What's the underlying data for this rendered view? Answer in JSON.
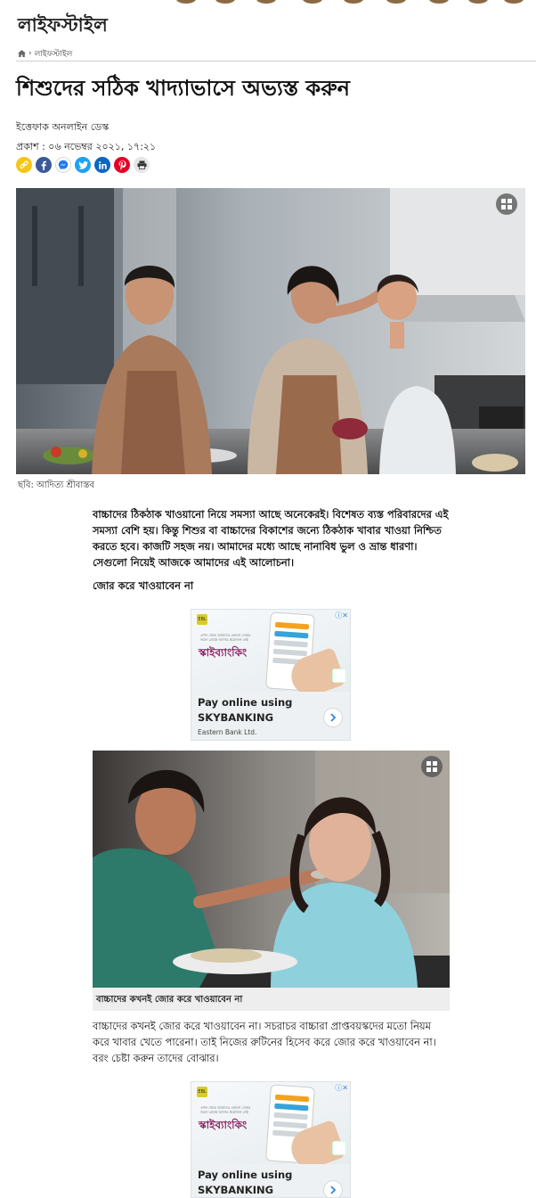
{
  "section": {
    "title": "লাইফস্টাইল"
  },
  "breadcrumb": {
    "home_icon": "home-icon",
    "separator": "›",
    "current": "লাইফস্টাইল"
  },
  "article": {
    "headline": "শিশুদের সঠিক খাদ্যাভাসে অভ্যস্ত করুন",
    "byline": "ইত্তেফাক অনলাইন ডেস্ক",
    "published": "প্রকাশ : ০৬ নভেম্বর ২০২১, ১৭:২১",
    "share_icons": [
      "link-icon",
      "facebook-icon",
      "messenger-icon",
      "twitter-icon",
      "linkedin-icon",
      "pinterest-icon",
      "print-icon"
    ],
    "main_image_caption": "ছবি: আদিত্য শ্রীবাস্তব",
    "intro": "বাচ্চাদের ঠিকঠাক খাওয়ানো নিয়ে সমস্যা আছে অনেকেরই। বিশেষত ব্যস্ত পরিবারদের এই সমস্যা বেশি হয়। কিন্তু শিশুর বা বাচ্চাদের বিকাশের জন্যে ঠিকঠাক খাবার খাওয়া নিশ্চিত করতে হবে। কাজটি সহজ নয়। আমাদের মধ্যে আছে নানাবিধ ভুল ও ভ্রান্ত ধারণা। সেগুলো নিয়েই আজকে আমাদের এই আলোচনা।",
    "subheading": "জোর করে খাওয়াবেন না",
    "second_image_caption": "বাচ্চাদের কখনই জোর করে খাওয়াবেন না",
    "paragraph2": "বাচ্চাদের কখনই জোর করে খাওয়াবেন না। সচরাচর বাচ্চারা প্রাপ্তবয়স্কদের মতো নিয়ম করে খাবার খেতে পারেনা। তাই নিজের রুটিনের হিসেব করে জোর করে খাওয়াবেন না। বরং চেষ্টা করুন তাদের বোঝার।"
  },
  "ads": [
    {
      "small_text": "এখন থেকে আমাদের কোনো সেবার জন্যে ব্রাঞ্চে আসার প্রয়োজন নেই",
      "brand": "স্কাইব্যাংকিং",
      "headline": "Pay online using SKYBANKING",
      "advertiser": "Eastern Bank Ltd.",
      "choices": "ⓘ✕"
    },
    {
      "small_text": "এখন থেকে আমাদের কোনো সেবার জন্যে ব্রাঞ্চে আসার প্রয়োজন নেই",
      "brand": "স্কাইব্যাংকিং",
      "headline": "Pay online using SKYBANKING",
      "advertiser": "",
      "choices": "ⓘ✕"
    }
  ],
  "colors": {
    "ad_brand": "#8a2060",
    "facebook": "#3b5998",
    "twitter": "#1da1f2",
    "linkedin": "#0a66c2",
    "pinterest": "#e60023"
  }
}
